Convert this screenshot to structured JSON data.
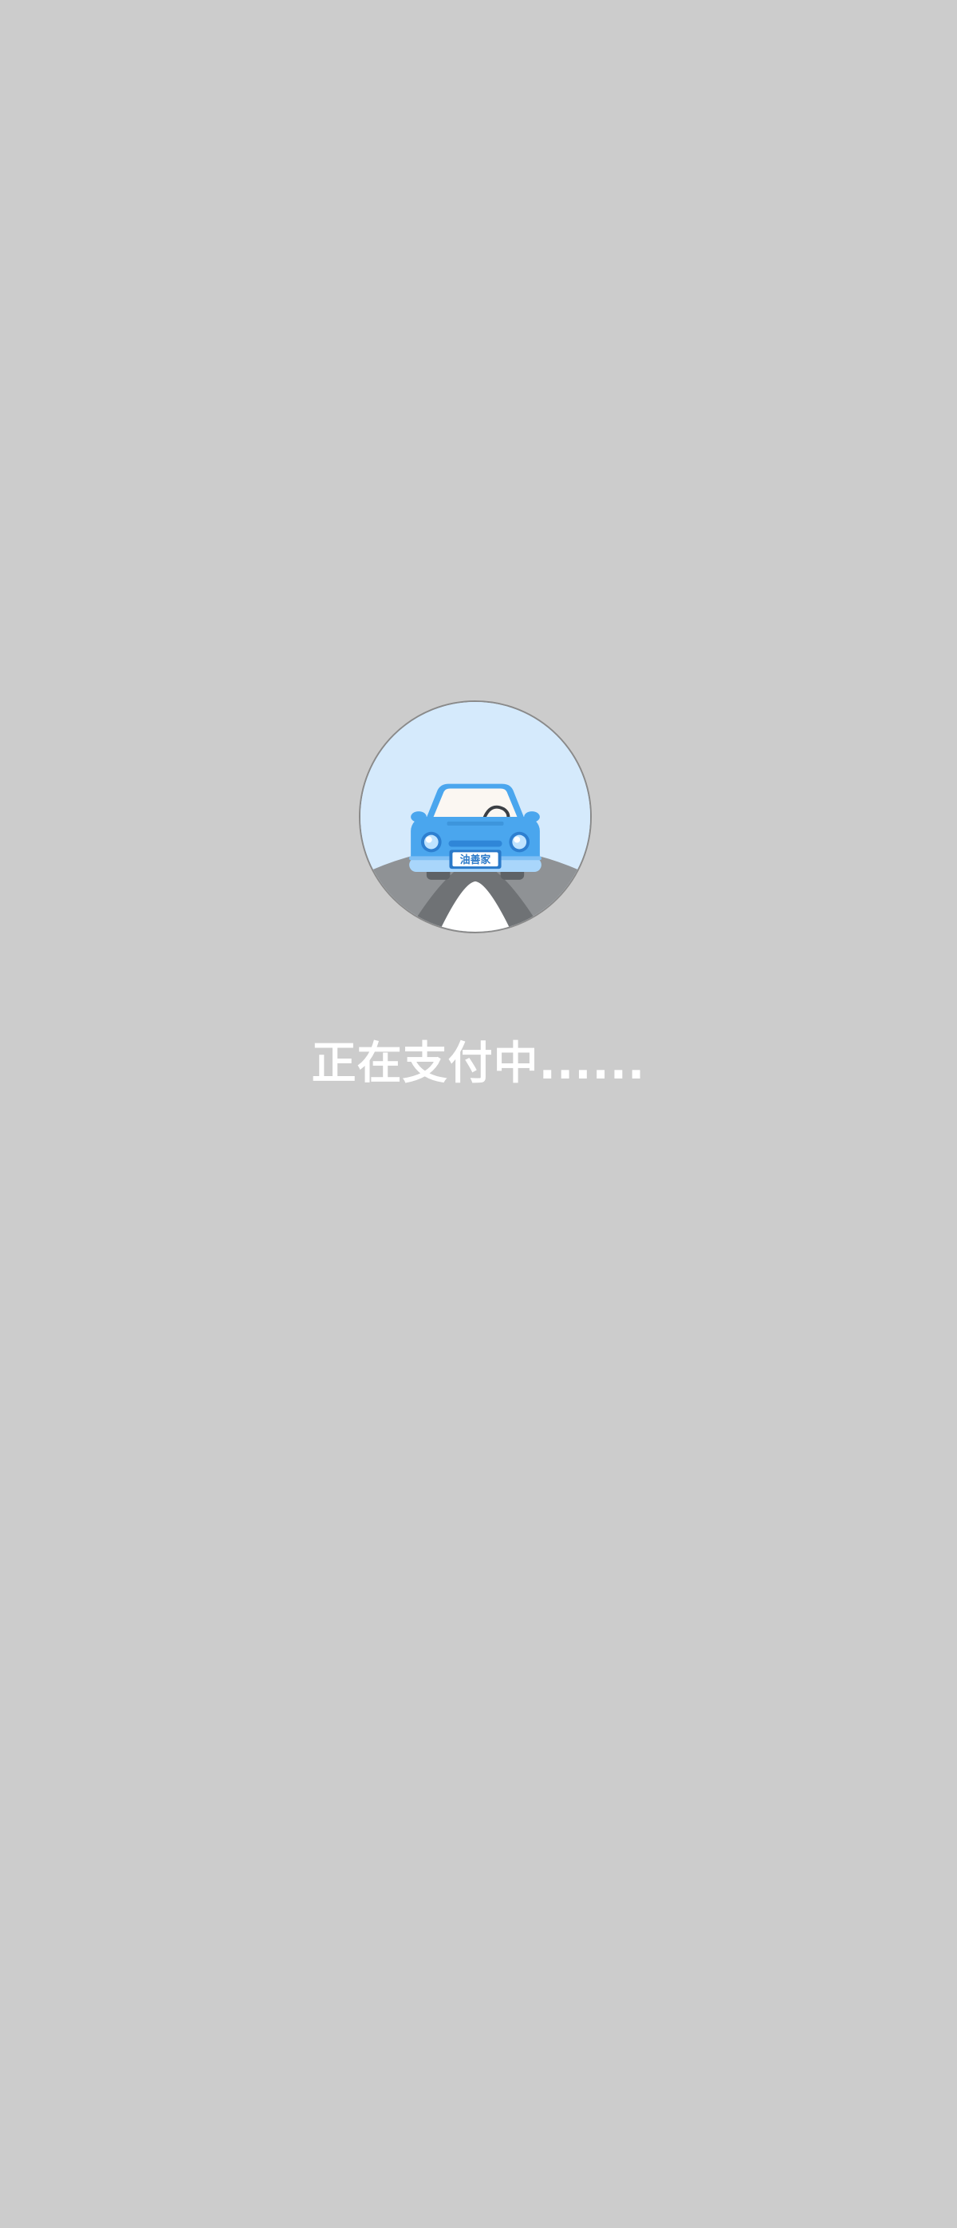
{
  "loader": {
    "illustration": "car-on-road-illustration",
    "plate_text": "油善家"
  },
  "status": {
    "message": "正在支付中......"
  },
  "colors": {
    "background": "#cccccc",
    "badge_background": "#d5eafc",
    "car_body": "#4aa6ee",
    "road": "#8f9295",
    "text": "#ffffff"
  }
}
